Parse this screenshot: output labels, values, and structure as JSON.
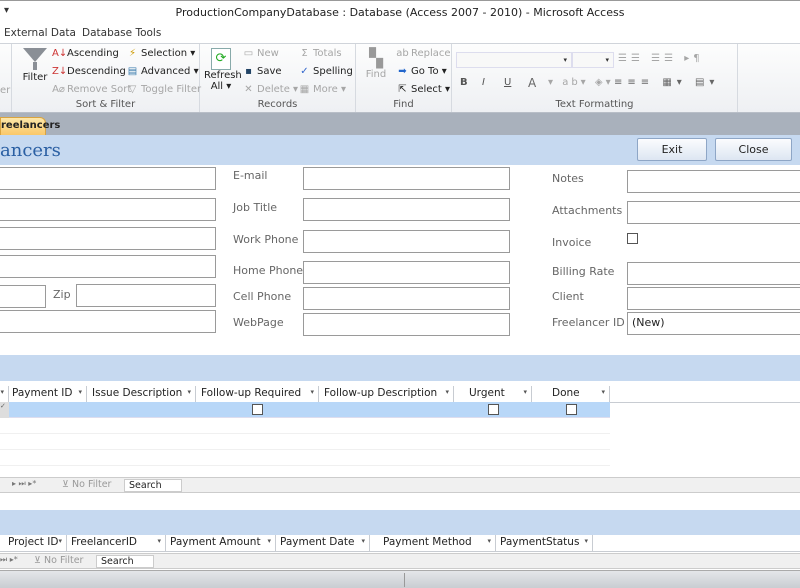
{
  "window": {
    "title": "ProductionCompanyDatabase : Database (Access 2007 - 2010)  -  Microsoft Access",
    "qat": "▾"
  },
  "ribbon_tabs": [
    "External Data",
    "Database Tools"
  ],
  "ribbon": {
    "sort_filter": {
      "label": "Sort & Filter",
      "filter": "Filter",
      "ascending": "Ascending",
      "descending": "Descending",
      "remove_sort": "Remove Sort",
      "selection": "Selection",
      "advanced": "Advanced",
      "toggle_filter": "Toggle Filter",
      "cut_label": "er"
    },
    "records": {
      "label": "Records",
      "refresh": "Refresh",
      "refresh2": "All",
      "new": "New",
      "save": "Save",
      "delete": "Delete",
      "totals": "Totals",
      "spelling": "Spelling",
      "more": "More"
    },
    "find": {
      "label": "Find",
      "find": "Find",
      "replace": "Replace",
      "goto": "Go To",
      "select": "Select"
    },
    "text_formatting": {
      "label": "Text Formatting",
      "bold": "B",
      "italic": "I",
      "underline": "U",
      "font_color": "A"
    }
  },
  "document_tab": "reelancers",
  "form": {
    "title": "ancers",
    "exit": "Exit",
    "close": "Close",
    "zip_label": "Zip",
    "middle_labels": [
      "E-mail",
      "Job Title",
      "Work Phone",
      "Home Phone",
      "Cell Phone",
      "WebPage"
    ],
    "right_labels": [
      "Notes",
      "Attachments",
      "Invoice",
      "Billing Rate",
      "Client",
      "Freelancer ID"
    ],
    "freelancer_id_value": "(New)",
    "invoice_checked": false
  },
  "subform1": {
    "columns": [
      "Payment ID",
      "Issue Description",
      "Follow-up Required",
      "Follow-up Description",
      "Urgent",
      "Done"
    ],
    "nav": {
      "no_filter": "No Filter",
      "search": "Search"
    }
  },
  "subform2": {
    "columns": [
      "Project ID",
      "FreelancerID",
      "Payment Amount",
      "Payment Date",
      "Payment Method",
      "PaymentStatus"
    ],
    "nav": {
      "no_filter": "No Filter",
      "search": "Search"
    }
  },
  "colors": {
    "accent": "#2a5fa3",
    "band": "#c6d9f0",
    "selected_row": "#b8d7f8",
    "doc_tab": "#f9c86a"
  }
}
